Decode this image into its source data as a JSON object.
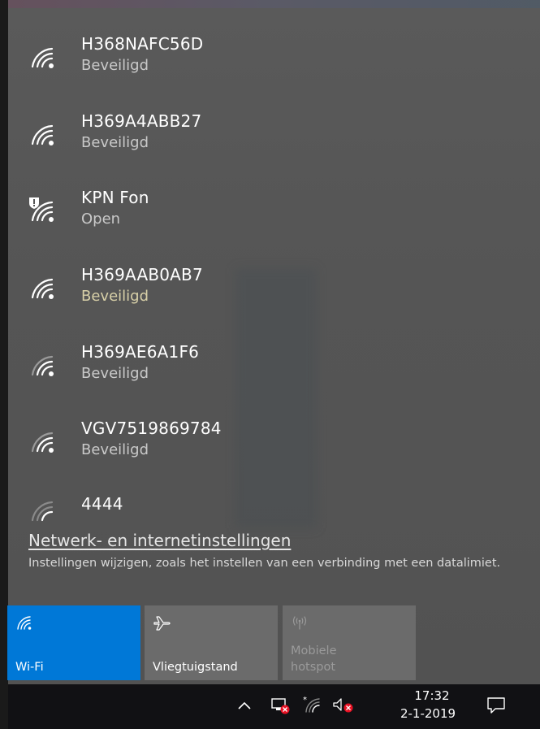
{
  "networks": [
    {
      "ssid": "H368NAFC56D",
      "status": "Beveiligd",
      "icon": "wifi-signal-icon"
    },
    {
      "ssid": "H369A4ABB27",
      "status": "Beveiligd",
      "icon": "wifi-signal-icon"
    },
    {
      "ssid": "KPN Fon",
      "status": "Open",
      "icon": "wifi-open-warning-icon"
    },
    {
      "ssid": "H369AAB0AB7",
      "status": "Beveiligd",
      "icon": "wifi-signal-icon"
    },
    {
      "ssid": "H369AE6A1F6",
      "status": "Beveiligd",
      "icon": "wifi-signal-icon"
    },
    {
      "ssid": "VGV7519869784",
      "status": "Beveiligd",
      "icon": "wifi-signal-icon"
    },
    {
      "ssid": "4444",
      "status": "",
      "icon": "wifi-weak-signal-icon"
    }
  ],
  "settings": {
    "link": "Netwerk- en internetinstellingen",
    "description": "Instellingen wijzigen, zoals het instellen van een verbinding met een datalimiet."
  },
  "quick_actions": {
    "wifi": "Wi-Fi",
    "airplane": "Vliegtuigstand",
    "hotspot": "Mobiele hotspot"
  },
  "taskbar": {
    "time": "17:32",
    "date": "2-1-2019",
    "icons": [
      "chevron-up-icon",
      "network-disconnected-icon",
      "wifi-icon",
      "volume-muted-icon",
      "action-center-icon"
    ]
  },
  "colors": {
    "accent": "#0078d7",
    "tile_inactive": "#6b6b6b",
    "taskbar": "#111114",
    "error_badge": "#e81123"
  }
}
